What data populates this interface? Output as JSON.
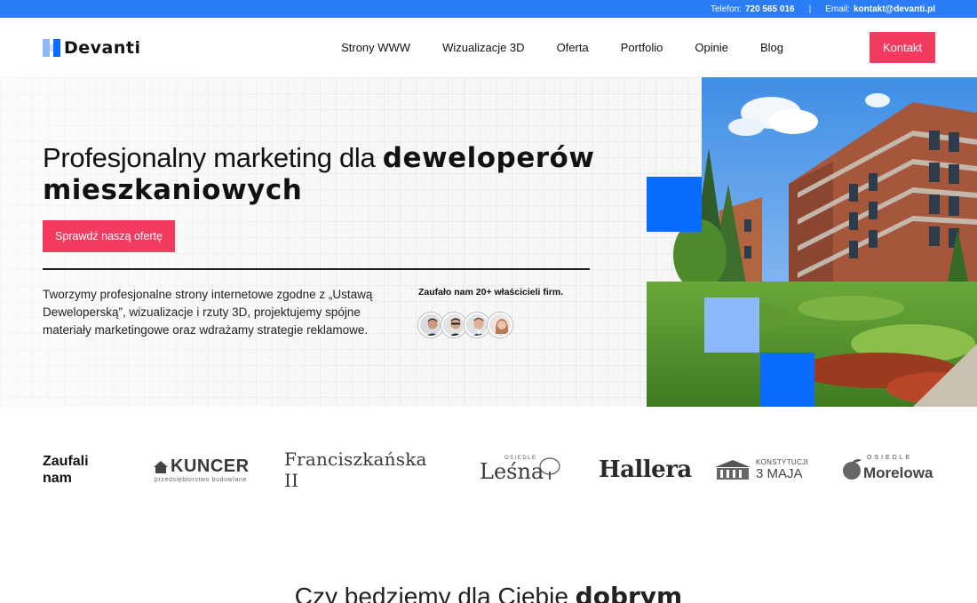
{
  "topbar": {
    "phone_label": "Telefon:",
    "phone_value": "720 565 016",
    "separator": "|",
    "email_label": "Email:",
    "email_value": "kontakt@devanti.pl"
  },
  "brand": {
    "name": "Devanti"
  },
  "nav": {
    "items": [
      {
        "label": "Strony WWW"
      },
      {
        "label": "Wizualizacje 3D"
      },
      {
        "label": "Oferta"
      },
      {
        "label": "Portfolio"
      },
      {
        "label": "Opinie"
      },
      {
        "label": "Blog"
      }
    ],
    "cta": "Kontakt"
  },
  "hero": {
    "title_regular": "Profesjonalny marketing dla ",
    "title_bold_1": "deweloperów",
    "title_bold_2": "mieszkaniowych",
    "button": "Sprawdź naszą ofertę",
    "description": "Tworzymy profesjonalne strony internetowe zgodne z „Ustawą Deweloperską”, wizualizacje i rzuty 3D, projektujemy spójne materiały marketingowe oraz wdrażamy strategie reklamowe.",
    "trust_text": "Zaufało nam 20+ właścicieli firm."
  },
  "clients": {
    "title_line1": "Zaufali",
    "title_line2": "nam",
    "logos": [
      {
        "name": "KUNCER",
        "sub": "przedsiębiorstwo budowlane"
      },
      {
        "name": "Franciszkańska II"
      },
      {
        "name": "Leśna",
        "pre": "OSIEDLE"
      },
      {
        "name": "Hallera"
      },
      {
        "name": "KONSTYTUCJI",
        "sub": "3 MAJA"
      },
      {
        "name": "Morelowa",
        "pre": "OSIEDLE"
      }
    ]
  },
  "next_section": {
    "regular": "Czy będziemy dla Ciebie ",
    "bold": "dobrym"
  },
  "colors": {
    "topbar": "#2b7df7",
    "accent_red": "#f23b5f",
    "blue_square": "#0a6cff",
    "light_blue_square": "#8db9fb"
  }
}
